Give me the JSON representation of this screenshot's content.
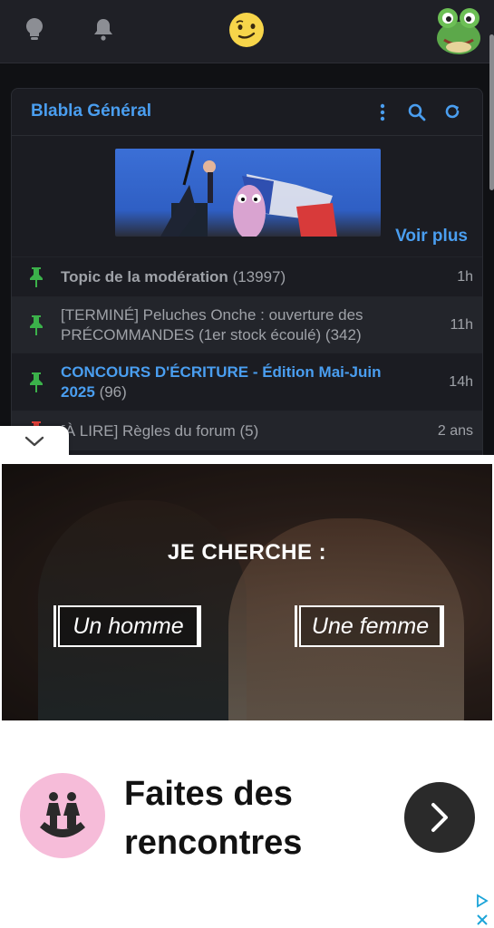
{
  "header": {
    "icons": [
      "lightbulb-icon",
      "bell-icon",
      "emoji-smirk-icon",
      "frog-avatar"
    ]
  },
  "forum": {
    "title": "Blabla Général",
    "see_more": "Voir plus",
    "topics": [
      {
        "pin_color": "#3bb14a",
        "title": "Topic de la modération",
        "count": "(13997)",
        "time": "1h",
        "highlight": false
      },
      {
        "pin_color": "#3bb14a",
        "title": "[TERMINÉ] Peluches Onche : ouverture des PRÉCOMMANDES (1er stock écoulé)",
        "count": "(342)",
        "time": "11h",
        "highlight": false
      },
      {
        "pin_color": "#3bb14a",
        "title": "CONCOURS D'ÉCRITURE - Édition Mai-Juin 2025",
        "count": "(96)",
        "time": "14h",
        "highlight": true
      },
      {
        "pin_color": "#e0403a",
        "title": "[À LIRE] Règles du forum",
        "count": "(5)",
        "time": "2 ans",
        "highlight": false
      }
    ]
  },
  "ad": {
    "heading": "JE CHERCHE :",
    "choice_man": "Un homme",
    "choice_woman": "Une femme",
    "tagline_line1": "Faites des",
    "tagline_line2": "rencontres"
  },
  "colors": {
    "accent": "#4a9ef0",
    "pin_green": "#3bb14a",
    "pin_red": "#e0403a"
  }
}
